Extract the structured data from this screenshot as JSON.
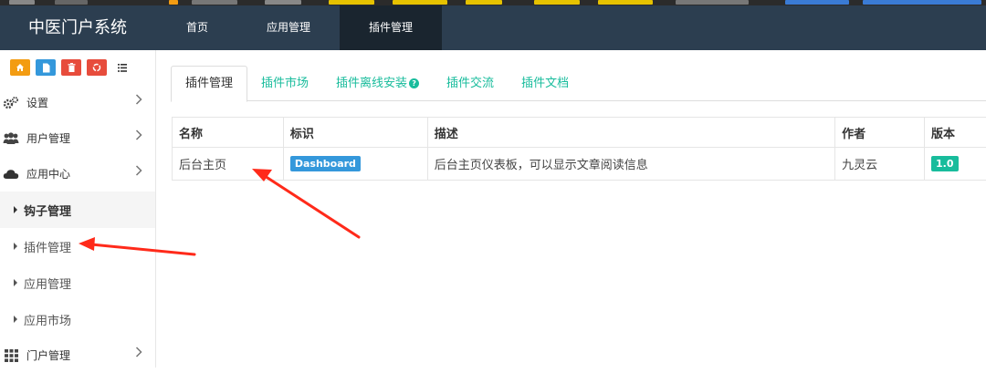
{
  "app": {
    "brand": "中医门户系统"
  },
  "topnav": {
    "items": [
      {
        "label": "首页"
      },
      {
        "label": "应用管理"
      },
      {
        "label": "插件管理"
      }
    ]
  },
  "shortcuts": {
    "colors": [
      "#f39c12",
      "#3498db",
      "#e74c3c",
      "#e74c3c"
    ]
  },
  "sidebar": {
    "items": [
      {
        "label": "设置",
        "icon": "gears-icon"
      },
      {
        "label": "用户管理",
        "icon": "users-icon"
      },
      {
        "label": "应用中心",
        "icon": "cloud-icon"
      }
    ],
    "subitems": [
      {
        "label": "钩子管理"
      },
      {
        "label": "插件管理"
      },
      {
        "label": "应用管理"
      },
      {
        "label": "应用市场"
      }
    ],
    "bottom_item": {
      "label": "门户管理",
      "icon": "grid-icon"
    }
  },
  "tabs": [
    {
      "label": "插件管理"
    },
    {
      "label": "插件市场"
    },
    {
      "label": "插件离线安装"
    },
    {
      "label": "插件交流"
    },
    {
      "label": "插件文档"
    }
  ],
  "table": {
    "headers": [
      "名称",
      "标识",
      "描述",
      "作者",
      "版本"
    ],
    "rows": [
      {
        "name": "后台主页",
        "id_badge": "Dashboard",
        "desc": "后台主页仪表板，可以显示文章阅读信息",
        "author": "九灵云",
        "version": "1.0"
      }
    ]
  },
  "colors": {
    "topbar": "#2c3e50",
    "accent": "#18bc9c",
    "badge_blue": "#3498db",
    "annotation_arrow": "#ff2a1a"
  }
}
